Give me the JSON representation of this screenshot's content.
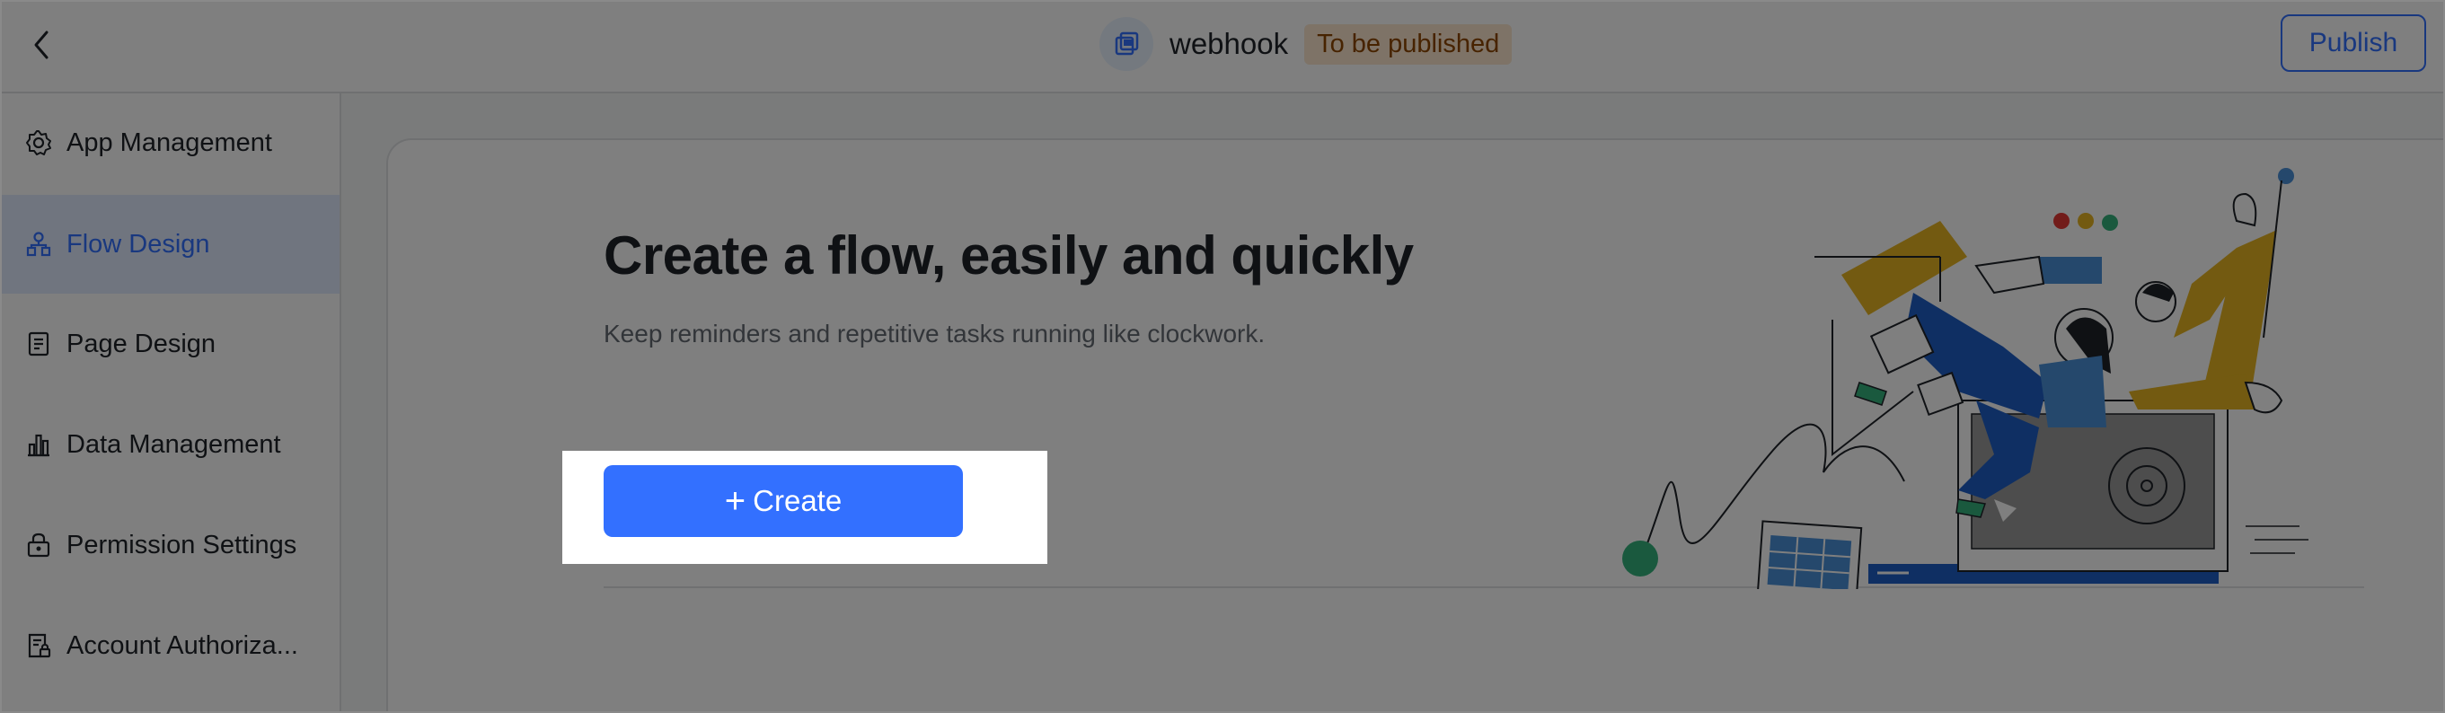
{
  "header": {
    "app_name": "webhook",
    "status_badge": "To be published",
    "publish_label": "Publish"
  },
  "sidebar": {
    "items": [
      {
        "label": "App Management",
        "icon": "gear-icon"
      },
      {
        "label": "Flow Design",
        "icon": "flow-icon",
        "active": true
      },
      {
        "label": "Page Design",
        "icon": "page-icon"
      },
      {
        "label": "Data Management",
        "icon": "chart-icon"
      },
      {
        "label": "Permission Settings",
        "icon": "lock-icon"
      },
      {
        "label": "Account Authoriza...",
        "icon": "account-icon"
      }
    ]
  },
  "main": {
    "headline": "Create a flow, easily and quickly",
    "subtitle": "Keep reminders and repetitive tasks running like clockwork.",
    "create_label": "Create"
  },
  "colors": {
    "accent": "#3370ff",
    "overlay": "rgba(0,0,0,0.5)",
    "badge_bg": "#fde6cf"
  }
}
